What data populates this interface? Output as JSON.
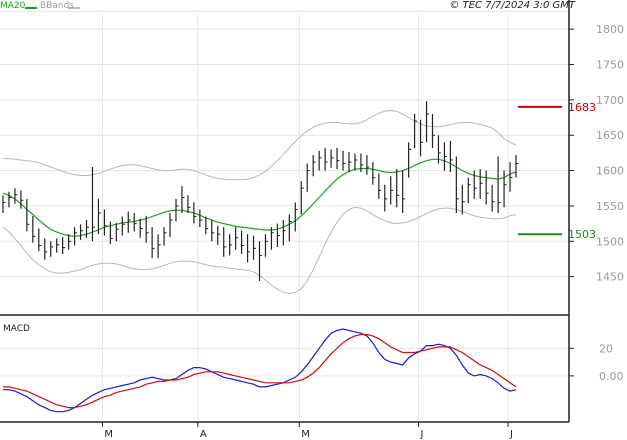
{
  "header": {
    "indicator_ma": "MA20",
    "indicator_bb": "BBands",
    "copyright": "© TEC 7/7/2024 3:0 GMT"
  },
  "colors": {
    "price_bars": "#222222",
    "ma": "#1aa31a",
    "bbands": "#b8b8b8",
    "grid": "#e6e6e6",
    "resistance": "#cc0000",
    "support": "#1a8a1a",
    "macd": "#1a1ad8",
    "signal": "#cc1111",
    "border": "#222222"
  },
  "chart_data": [
    {
      "type": "ohlc",
      "name": "price",
      "y_ticks": [
        1450,
        1500,
        1550,
        1600,
        1650,
        1700,
        1750,
        1800
      ],
      "ylim": [
        1400,
        1820
      ],
      "x_ticks": [
        "M",
        "A",
        "M",
        "J",
        "J"
      ],
      "grid": true,
      "levels": [
        {
          "label": "1683",
          "value": 1690,
          "role": "resistance"
        },
        {
          "label": "1503",
          "value": 1510,
          "role": "support"
        }
      ],
      "series": [
        {
          "name": "MA20",
          "values": [
            1568,
            1565,
            1560,
            1553,
            1545,
            1538,
            1530,
            1523,
            1517,
            1513,
            1510,
            1508,
            1507,
            1508,
            1510,
            1513,
            1516,
            1520,
            1522,
            1524,
            1526,
            1527,
            1528,
            1530,
            1532,
            1535,
            1538,
            1541,
            1543,
            1544,
            1544,
            1542,
            1540,
            1537,
            1533,
            1530,
            1527,
            1525,
            1523,
            1521,
            1520,
            1519,
            1518,
            1517,
            1516,
            1516,
            1517,
            1520,
            1524,
            1529,
            1536,
            1544,
            1553,
            1562,
            1571,
            1580,
            1588,
            1594,
            1599,
            1602,
            1603,
            1603,
            1602,
            1600,
            1598,
            1597,
            1598,
            1600,
            1603,
            1607,
            1611,
            1614,
            1616,
            1616,
            1614,
            1610,
            1605,
            1600,
            1596,
            1593,
            1591,
            1590,
            1589,
            1588,
            1590,
            1595,
            1598
          ]
        },
        {
          "name": "BBands upper",
          "values": [
            1617,
            1617,
            1616,
            1615,
            1614,
            1613,
            1611,
            1608,
            1605,
            1602,
            1599,
            1596,
            1594,
            1593,
            1593,
            1594,
            1596,
            1599,
            1602,
            1605,
            1607,
            1608,
            1608,
            1607,
            1605,
            1603,
            1601,
            1600,
            1600,
            1601,
            1602,
            1602,
            1600,
            1597,
            1594,
            1591,
            1589,
            1588,
            1587,
            1587,
            1587,
            1588,
            1590,
            1594,
            1599,
            1606,
            1614,
            1623,
            1632,
            1641,
            1649,
            1656,
            1661,
            1665,
            1667,
            1668,
            1668,
            1667,
            1666,
            1666,
            1668,
            1672,
            1677,
            1681,
            1684,
            1685,
            1684,
            1680,
            1675,
            1670,
            1666,
            1663,
            1662,
            1662,
            1663,
            1665,
            1667,
            1668,
            1668,
            1667,
            1665,
            1663,
            1660,
            1654,
            1645,
            1640,
            1636
          ]
        },
        {
          "name": "BBands lower",
          "values": [
            1520,
            1513,
            1504,
            1494,
            1483,
            1474,
            1467,
            1461,
            1457,
            1455,
            1455,
            1456,
            1458,
            1460,
            1463,
            1466,
            1468,
            1469,
            1469,
            1468,
            1466,
            1463,
            1461,
            1460,
            1460,
            1461,
            1463,
            1466,
            1469,
            1471,
            1472,
            1472,
            1471,
            1469,
            1467,
            1465,
            1464,
            1463,
            1462,
            1461,
            1460,
            1459,
            1457,
            1452,
            1445,
            1438,
            1432,
            1428,
            1426,
            1428,
            1433,
            1444,
            1460,
            1478,
            1496,
            1513,
            1527,
            1538,
            1545,
            1548,
            1547,
            1543,
            1538,
            1533,
            1529,
            1526,
            1525,
            1526,
            1528,
            1531,
            1535,
            1539,
            1543,
            1546,
            1547,
            1547,
            1545,
            1542,
            1539,
            1536,
            1534,
            1533,
            1532,
            1532,
            1533,
            1536,
            1538
          ]
        }
      ],
      "bars": [
        {
          "h": 1565,
          "l": 1540,
          "c": 1555
        },
        {
          "h": 1570,
          "l": 1548,
          "c": 1562
        },
        {
          "h": 1575,
          "l": 1553,
          "c": 1566
        },
        {
          "h": 1572,
          "l": 1546,
          "c": 1558
        },
        {
          "h": 1560,
          "l": 1514,
          "c": 1524
        },
        {
          "h": 1536,
          "l": 1498,
          "c": 1507
        },
        {
          "h": 1518,
          "l": 1486,
          "c": 1494
        },
        {
          "h": 1504,
          "l": 1474,
          "c": 1485
        },
        {
          "h": 1500,
          "l": 1478,
          "c": 1492
        },
        {
          "h": 1504,
          "l": 1484,
          "c": 1495
        },
        {
          "h": 1506,
          "l": 1482,
          "c": 1491
        },
        {
          "h": 1510,
          "l": 1488,
          "c": 1500
        },
        {
          "h": 1520,
          "l": 1494,
          "c": 1512
        },
        {
          "h": 1524,
          "l": 1502,
          "c": 1515
        },
        {
          "h": 1530,
          "l": 1505,
          "c": 1520
        },
        {
          "h": 1605,
          "l": 1500,
          "c": 1520
        },
        {
          "h": 1560,
          "l": 1510,
          "c": 1540
        },
        {
          "h": 1545,
          "l": 1508,
          "c": 1522
        },
        {
          "h": 1528,
          "l": 1496,
          "c": 1504
        },
        {
          "h": 1526,
          "l": 1500,
          "c": 1517
        },
        {
          "h": 1535,
          "l": 1508,
          "c": 1524
        },
        {
          "h": 1542,
          "l": 1512,
          "c": 1530
        },
        {
          "h": 1540,
          "l": 1514,
          "c": 1525
        },
        {
          "h": 1532,
          "l": 1505,
          "c": 1518
        },
        {
          "h": 1536,
          "l": 1498,
          "c": 1512
        },
        {
          "h": 1520,
          "l": 1476,
          "c": 1490
        },
        {
          "h": 1510,
          "l": 1476,
          "c": 1495
        },
        {
          "h": 1520,
          "l": 1494,
          "c": 1512
        },
        {
          "h": 1540,
          "l": 1506,
          "c": 1530
        },
        {
          "h": 1560,
          "l": 1528,
          "c": 1550
        },
        {
          "h": 1578,
          "l": 1540,
          "c": 1562
        },
        {
          "h": 1565,
          "l": 1540,
          "c": 1548
        },
        {
          "h": 1555,
          "l": 1525,
          "c": 1535
        },
        {
          "h": 1545,
          "l": 1520,
          "c": 1530
        },
        {
          "h": 1535,
          "l": 1510,
          "c": 1518
        },
        {
          "h": 1530,
          "l": 1500,
          "c": 1512
        },
        {
          "h": 1522,
          "l": 1495,
          "c": 1510
        },
        {
          "h": 1520,
          "l": 1478,
          "c": 1492
        },
        {
          "h": 1510,
          "l": 1480,
          "c": 1495
        },
        {
          "h": 1520,
          "l": 1488,
          "c": 1505
        },
        {
          "h": 1515,
          "l": 1482,
          "c": 1494
        },
        {
          "h": 1510,
          "l": 1470,
          "c": 1485
        },
        {
          "h": 1508,
          "l": 1474,
          "c": 1490
        },
        {
          "h": 1500,
          "l": 1444,
          "c": 1480
        },
        {
          "h": 1510,
          "l": 1478,
          "c": 1500
        },
        {
          "h": 1520,
          "l": 1488,
          "c": 1512
        },
        {
          "h": 1525,
          "l": 1492,
          "c": 1508
        },
        {
          "h": 1530,
          "l": 1494,
          "c": 1515
        },
        {
          "h": 1538,
          "l": 1500,
          "c": 1528
        },
        {
          "h": 1555,
          "l": 1514,
          "c": 1545
        },
        {
          "h": 1585,
          "l": 1538,
          "c": 1575
        },
        {
          "h": 1610,
          "l": 1570,
          "c": 1600
        },
        {
          "h": 1622,
          "l": 1592,
          "c": 1612
        },
        {
          "h": 1628,
          "l": 1600,
          "c": 1618
        },
        {
          "h": 1632,
          "l": 1600,
          "c": 1612
        },
        {
          "h": 1630,
          "l": 1604,
          "c": 1618
        },
        {
          "h": 1632,
          "l": 1602,
          "c": 1614
        },
        {
          "h": 1628,
          "l": 1600,
          "c": 1610
        },
        {
          "h": 1626,
          "l": 1598,
          "c": 1612
        },
        {
          "h": 1624,
          "l": 1600,
          "c": 1615
        },
        {
          "h": 1624,
          "l": 1598,
          "c": 1608
        },
        {
          "h": 1622,
          "l": 1594,
          "c": 1605
        },
        {
          "h": 1612,
          "l": 1580,
          "c": 1590
        },
        {
          "h": 1596,
          "l": 1560,
          "c": 1572
        },
        {
          "h": 1580,
          "l": 1542,
          "c": 1560
        },
        {
          "h": 1592,
          "l": 1552,
          "c": 1572
        },
        {
          "h": 1602,
          "l": 1548,
          "c": 1565
        },
        {
          "h": 1600,
          "l": 1540,
          "c": 1560
        },
        {
          "h": 1640,
          "l": 1590,
          "c": 1630
        },
        {
          "h": 1680,
          "l": 1632,
          "c": 1670
        },
        {
          "h": 1672,
          "l": 1620,
          "c": 1640
        },
        {
          "h": 1698,
          "l": 1640,
          "c": 1680
        },
        {
          "h": 1680,
          "l": 1632,
          "c": 1650
        },
        {
          "h": 1650,
          "l": 1610,
          "c": 1625
        },
        {
          "h": 1640,
          "l": 1600,
          "c": 1620
        },
        {
          "h": 1642,
          "l": 1598,
          "c": 1615
        },
        {
          "h": 1620,
          "l": 1540,
          "c": 1560
        },
        {
          "h": 1580,
          "l": 1538,
          "c": 1556
        },
        {
          "h": 1590,
          "l": 1554,
          "c": 1580
        },
        {
          "h": 1600,
          "l": 1560,
          "c": 1575
        },
        {
          "h": 1602,
          "l": 1560,
          "c": 1582
        },
        {
          "h": 1600,
          "l": 1552,
          "c": 1568
        },
        {
          "h": 1580,
          "l": 1542,
          "c": 1556
        },
        {
          "h": 1620,
          "l": 1540,
          "c": 1555
        },
        {
          "h": 1600,
          "l": 1548,
          "c": 1580
        },
        {
          "h": 1612,
          "l": 1570,
          "c": 1590
        },
        {
          "h": 1622,
          "l": 1590,
          "c": 1610
        }
      ]
    },
    {
      "type": "line",
      "name": "MACD",
      "title": "MACD",
      "y_ticks": [
        0,
        20
      ],
      "y_tick_labels": [
        "0.00",
        "20"
      ],
      "ylim": [
        -32,
        42
      ],
      "series": [
        {
          "name": "MACD",
          "values": [
            -10,
            -10,
            -11,
            -13,
            -15,
            -18,
            -21,
            -23,
            -25,
            -26,
            -26,
            -25,
            -23,
            -20,
            -17,
            -14,
            -12,
            -10,
            -9,
            -8,
            -7,
            -6,
            -5,
            -3,
            -2,
            -1,
            -2,
            -3,
            -3,
            -2,
            1,
            4,
            6,
            6,
            5,
            3,
            1,
            -1,
            -2,
            -3,
            -4,
            -5,
            -6,
            -8,
            -8,
            -7,
            -6,
            -5,
            -3,
            -1,
            3,
            8,
            14,
            20,
            26,
            31,
            33,
            34,
            33,
            32,
            31,
            29,
            24,
            17,
            12,
            10,
            9,
            8,
            13,
            16,
            18,
            22,
            22,
            23,
            22,
            20,
            15,
            8,
            2,
            0,
            1,
            0,
            -2,
            -5,
            -9,
            -11,
            -10
          ]
        },
        {
          "name": "Signal",
          "values": [
            -8,
            -8,
            -9,
            -10,
            -11,
            -13,
            -15,
            -17,
            -19,
            -21,
            -22,
            -23,
            -23,
            -22,
            -21,
            -19,
            -17,
            -15,
            -14,
            -12,
            -11,
            -10,
            -9,
            -8,
            -6,
            -5,
            -4,
            -4,
            -3,
            -3,
            -2,
            -1,
            1,
            2,
            3,
            3,
            3,
            2,
            1,
            0,
            -1,
            -2,
            -3,
            -4,
            -5,
            -5,
            -5,
            -5,
            -5,
            -4,
            -3,
            -1,
            2,
            6,
            11,
            16,
            20,
            24,
            27,
            29,
            30,
            30,
            29,
            27,
            24,
            21,
            19,
            17,
            17,
            17,
            18,
            19,
            20,
            21,
            21,
            21,
            19,
            17,
            14,
            11,
            8,
            6,
            4,
            1,
            -2,
            -5,
            -8
          ]
        }
      ]
    }
  ]
}
